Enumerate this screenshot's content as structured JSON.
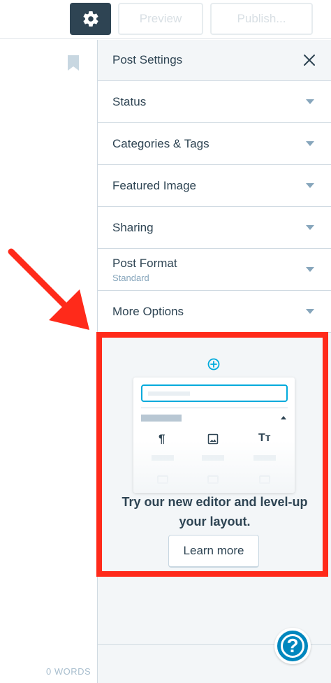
{
  "toolbar": {
    "settings_icon": "gear-icon",
    "preview_label": "Preview",
    "publish_label": "Publish..."
  },
  "editor": {
    "bookmark_icon": "bookmark-icon",
    "word_count": "0 WORDS"
  },
  "sidebar": {
    "title": "Post Settings",
    "close_icon": "close-icon",
    "panels": [
      {
        "label": "Status",
        "sub": ""
      },
      {
        "label": "Categories & Tags",
        "sub": ""
      },
      {
        "label": "Featured Image",
        "sub": ""
      },
      {
        "label": "Sharing",
        "sub": ""
      },
      {
        "label": "Post Format",
        "sub": "Standard"
      },
      {
        "label": "More Options",
        "sub": ""
      }
    ]
  },
  "promo": {
    "add_icon": "plus-circle-icon",
    "text": "Try our new editor and level-up your layout.",
    "button_label": "Learn more"
  },
  "help": {
    "icon": "question-mark-icon",
    "label": "?"
  },
  "colors": {
    "accent": "#0087be",
    "dark": "#2e4453",
    "highlight": "#ff2a1a"
  }
}
